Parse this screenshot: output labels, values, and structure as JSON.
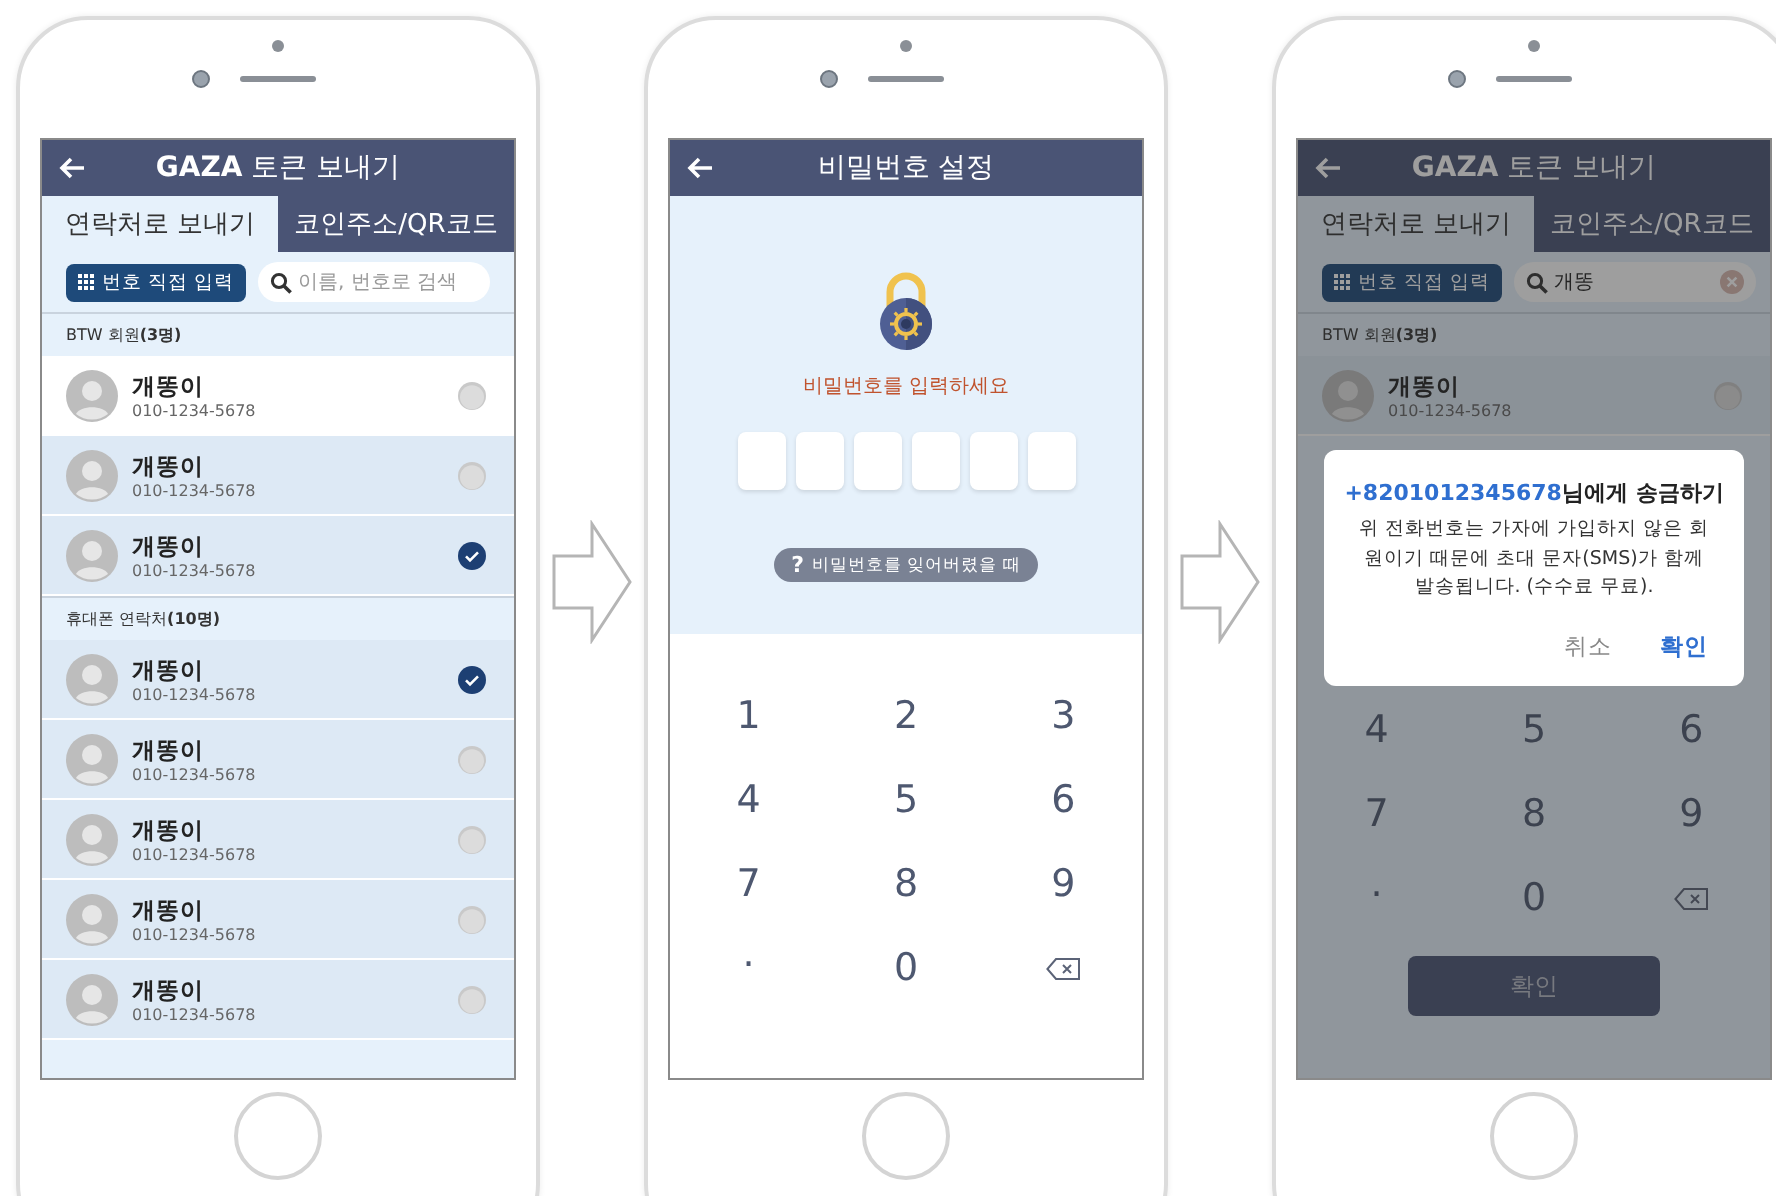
{
  "contacts_screen": {
    "title": "**GAZA** 토큰 보내기",
    "tabs": [
      {
        "label": "연락처로 보내기",
        "selected": true
      },
      {
        "label": "코인주소/QR코드",
        "selected": false
      }
    ],
    "direct_input_button": "번호 직접 입력",
    "search": {
      "placeholder": "이름, 번호로 검색"
    },
    "groups": [
      {
        "title": "BTW 회원**(3명)**",
        "contacts": [
          {
            "name": "개똥이",
            "phone": "010-1234-5678",
            "checked": false,
            "highlighted": true
          },
          {
            "name": "개똥이",
            "phone": "010-1234-5678",
            "checked": false,
            "highlighted": false
          },
          {
            "name": "개똥이",
            "phone": "010-1234-5678",
            "checked": true,
            "highlighted": false
          }
        ]
      },
      {
        "title": "휴대폰 연락처**(10명)**",
        "contacts": [
          {
            "name": "개똥이",
            "phone": "010-1234-5678",
            "checked": true,
            "highlighted": false
          },
          {
            "name": "개똥이",
            "phone": "010-1234-5678",
            "checked": false,
            "highlighted": false
          },
          {
            "name": "개똥이",
            "phone": "010-1234-5678",
            "checked": false,
            "highlighted": false
          },
          {
            "name": "개똥이",
            "phone": "010-1234-5678",
            "checked": false,
            "highlighted": false
          },
          {
            "name": "개똥이",
            "phone": "010-1234-5678",
            "checked": false,
            "highlighted": false
          }
        ]
      }
    ]
  },
  "password_screen": {
    "title": "비밀번호 설정",
    "prompt": "비밀번호를 입력하세요",
    "pin_slots": [
      {
        "filled": false
      },
      {
        "filled": false
      },
      {
        "filled": false
      },
      {
        "filled": false
      },
      {
        "filled": false
      },
      {
        "filled": false
      }
    ],
    "help_glyph": "?",
    "forgot_link": "비밀번호를 잊어버렸을 때",
    "keypad": [
      {
        "kind": "digit",
        "label": "1"
      },
      {
        "kind": "digit",
        "label": "2"
      },
      {
        "kind": "digit",
        "label": "3"
      },
      {
        "kind": "digit",
        "label": "4"
      },
      {
        "kind": "digit",
        "label": "5"
      },
      {
        "kind": "digit",
        "label": "6"
      },
      {
        "kind": "digit",
        "label": "7"
      },
      {
        "kind": "digit",
        "label": "8"
      },
      {
        "kind": "digit",
        "label": "9"
      },
      {
        "kind": "symbol",
        "label": "."
      },
      {
        "kind": "digit",
        "label": "0"
      },
      {
        "kind": "backspace"
      }
    ]
  },
  "confirm_screen": {
    "title": "**GAZA** 토큰 보내기",
    "tabs": [
      {
        "label": "연락처로 보내기",
        "selected": true
      },
      {
        "label": "코인주소/QR코드",
        "selected": false
      }
    ],
    "direct_input_button": "번호 직접 입력",
    "search": {
      "value": "개똥"
    },
    "groups": [
      {
        "title": "BTW 회원**(3명)**",
        "contacts": [
          {
            "name": "개똥이",
            "phone": "010-1234-5678",
            "checked": false,
            "highlighted": false
          }
        ]
      }
    ],
    "keypad": [
      {
        "kind": "digit",
        "label": "4"
      },
      {
        "kind": "digit",
        "label": "5"
      },
      {
        "kind": "digit",
        "label": "6"
      },
      {
        "kind": "digit",
        "label": "7"
      },
      {
        "kind": "digit",
        "label": "8"
      },
      {
        "kind": "digit",
        "label": "9"
      },
      {
        "kind": "symbol",
        "label": "."
      },
      {
        "kind": "digit",
        "label": "0"
      },
      {
        "kind": "backspace"
      }
    ],
    "confirm_button": "확인",
    "dialog": {
      "recipient": "+8201012345678",
      "title": "님에게 송금하기",
      "message": "위 전화번호는 가자에 가입하지 않은 회원이기 때문에 초대 문자(SMS)가 함께 발송됩니다. (수수료 무료).",
      "buttons": [
        {
          "kind": "cancel",
          "label": "취소"
        },
        {
          "kind": "confirm",
          "label": "확인"
        }
      ]
    }
  }
}
